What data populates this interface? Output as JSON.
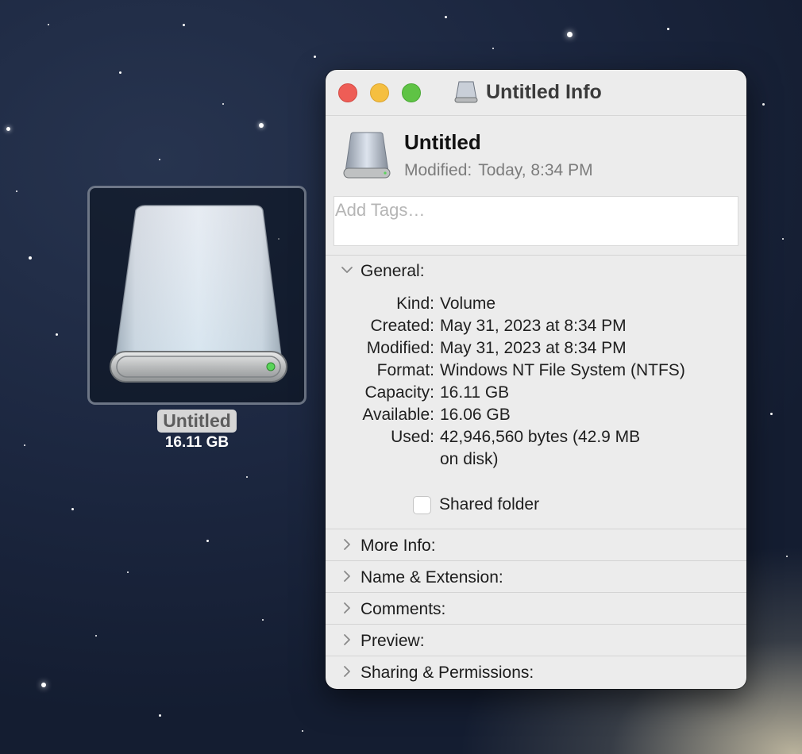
{
  "desktop": {
    "volume_label": "Untitled",
    "volume_size": "16.11 GB"
  },
  "window": {
    "title": "Untitled Info",
    "controls": [
      "close",
      "minimize",
      "zoom"
    ]
  },
  "header": {
    "name": "Untitled",
    "modified_label": "Modified:",
    "modified_value": "Today, 8:34 PM"
  },
  "tags": {
    "placeholder": "Add Tags…",
    "value": ""
  },
  "general": {
    "title": "General:",
    "expanded": true,
    "rows": [
      {
        "key": "Kind:",
        "value": "Volume"
      },
      {
        "key": "Created:",
        "value": "May 31, 2023 at 8:34 PM"
      },
      {
        "key": "Modified:",
        "value": "May 31, 2023 at 8:34 PM"
      },
      {
        "key": "Format:",
        "value": "Windows NT File System (NTFS)"
      },
      {
        "key": "Capacity:",
        "value": "16.11 GB"
      },
      {
        "key": "Available:",
        "value": "16.06 GB"
      },
      {
        "key": "Used:",
        "value": "42,946,560 bytes (42.9 MB"
      },
      {
        "key": "",
        "value": "on disk)"
      }
    ],
    "shared_folder_label": "Shared folder",
    "shared_folder_checked": false
  },
  "sections": [
    {
      "title": "More Info:"
    },
    {
      "title": "Name & Extension:"
    },
    {
      "title": "Comments:"
    },
    {
      "title": "Preview:"
    },
    {
      "title": "Sharing & Permissions:"
    }
  ],
  "icons": [
    "drive-icon",
    "chevron-down-icon",
    "chevron-right-icon"
  ],
  "colors": {
    "close": "#ee5d56",
    "minimize": "#f5bf40",
    "zoom": "#5fc345",
    "window_bg": "#ececec",
    "drive_light": "#5ad45a"
  }
}
